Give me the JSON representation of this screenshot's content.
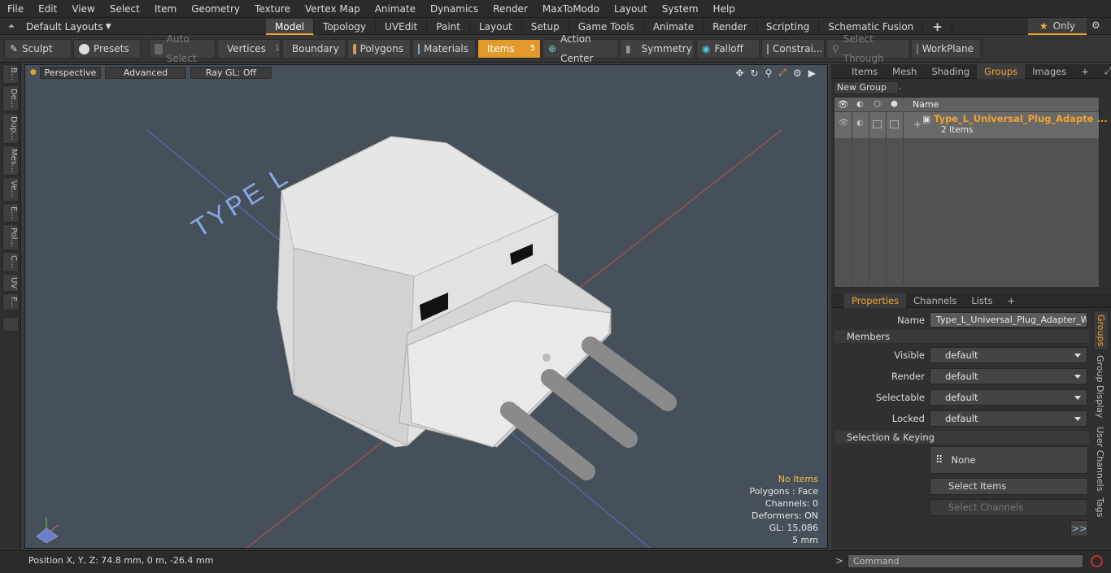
{
  "menu": [
    "File",
    "Edit",
    "View",
    "Select",
    "Item",
    "Geometry",
    "Texture",
    "Vertex Map",
    "Animate",
    "Dynamics",
    "Render",
    "MaxToModo",
    "Layout",
    "System",
    "Help"
  ],
  "layouts": "Default Layouts",
  "modes": [
    "Model",
    "Topology",
    "UVEdit",
    "Paint",
    "Layout",
    "Setup",
    "Game Tools",
    "Animate",
    "Render",
    "Scripting",
    "Schematic Fusion"
  ],
  "only_label": "Only",
  "toolbar": {
    "sculpt": "Sculpt",
    "presets": "Presets",
    "auto_select": "Auto Select",
    "vertices": "Vertices",
    "vertices_count": "1",
    "boundary": "Boundary",
    "polygons": "Polygons",
    "materials": "Materials",
    "items": "Items",
    "items_count": "5",
    "action_center": "Action Center",
    "symmetry": "Symmetry",
    "falloff": "Falloff",
    "constraints": "Constrai...",
    "select_through": "Select Through",
    "workplane": "WorkPlane"
  },
  "left_tabs": [
    "B...",
    "De...",
    "Dup...",
    "Mes...",
    "Ve...",
    "E...",
    "Pol...",
    "C...",
    "UV",
    "F..."
  ],
  "viewport": {
    "view": "Perspective",
    "shading": "Advanced",
    "raygl": "Ray GL: Off",
    "model_text": "TYPE L",
    "hud": {
      "items": "No Items",
      "polygons": "Polygons : Face",
      "channels": "Channels: 0",
      "deformers": "Deformers: ON",
      "gl": "GL: 15,086",
      "unit": "5 mm"
    }
  },
  "items_panel": {
    "tabs": [
      "Items",
      "Mesh ...",
      "Shading",
      "Groups",
      "Images"
    ],
    "new_group": "New Group",
    "col_name": "Name",
    "group_name": "Type_L_Universal_Plug_Adapte ...",
    "group_count": "2 Items"
  },
  "properties": {
    "tabs": [
      "Properties",
      "Channels",
      "Lists"
    ],
    "name_label": "Name",
    "name_value": "Type_L_Universal_Plug_Adapter_Whit",
    "members": "Members",
    "rows": [
      {
        "label": "Visible",
        "value": "default"
      },
      {
        "label": "Render",
        "value": "default"
      },
      {
        "label": "Selectable",
        "value": "default"
      },
      {
        "label": "Locked",
        "value": "default"
      }
    ],
    "sel_keying": "Selection & Keying",
    "none": "None",
    "select_items": "Select Items",
    "select_channels": "Select Channels",
    "more": ">>",
    "side_tabs": [
      "Groups",
      "Group Display",
      "User Channels",
      "Tags"
    ]
  },
  "status": {
    "position": "Position X, Y, Z:   74.8 mm, 0 m, -26.4 mm",
    "command": "Command"
  },
  "colors": {
    "accent": "#e39a2a",
    "viewport": "#46505a"
  }
}
